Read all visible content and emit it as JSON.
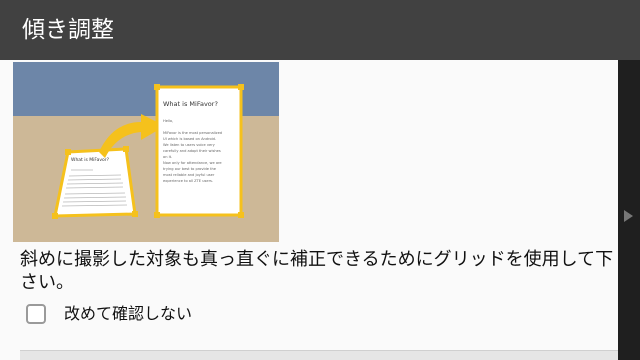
{
  "dialog": {
    "title": "傾き調整",
    "description": "斜めに撮影した対象も真っ直ぐに補正できるためにグリッドを使用して下さい。",
    "checkbox_label": "改めて確認しない",
    "checkbox_checked": false
  },
  "illustration": {
    "small_doc_title": "What is MiFavor?",
    "large_doc_title": "What is MiFavor?",
    "large_doc_lines": [
      "Hello,",
      "MiFavor is the most personalized",
      "UI which is based on Android.",
      "We listen to users voice very",
      "carefully and adopt their wishes",
      "on it.",
      "Now only for attendance, we are",
      "trying our best to provide the",
      "most reliable and joyful user",
      "experience to all ZTE users."
    ],
    "colors": {
      "wall": "#6d86a8",
      "floor": "#cdb897",
      "accent": "#f5c11c",
      "paper": "#ffffff"
    }
  },
  "colors": {
    "title_bar": "#414141",
    "dialog_bg": "#fafafa"
  }
}
